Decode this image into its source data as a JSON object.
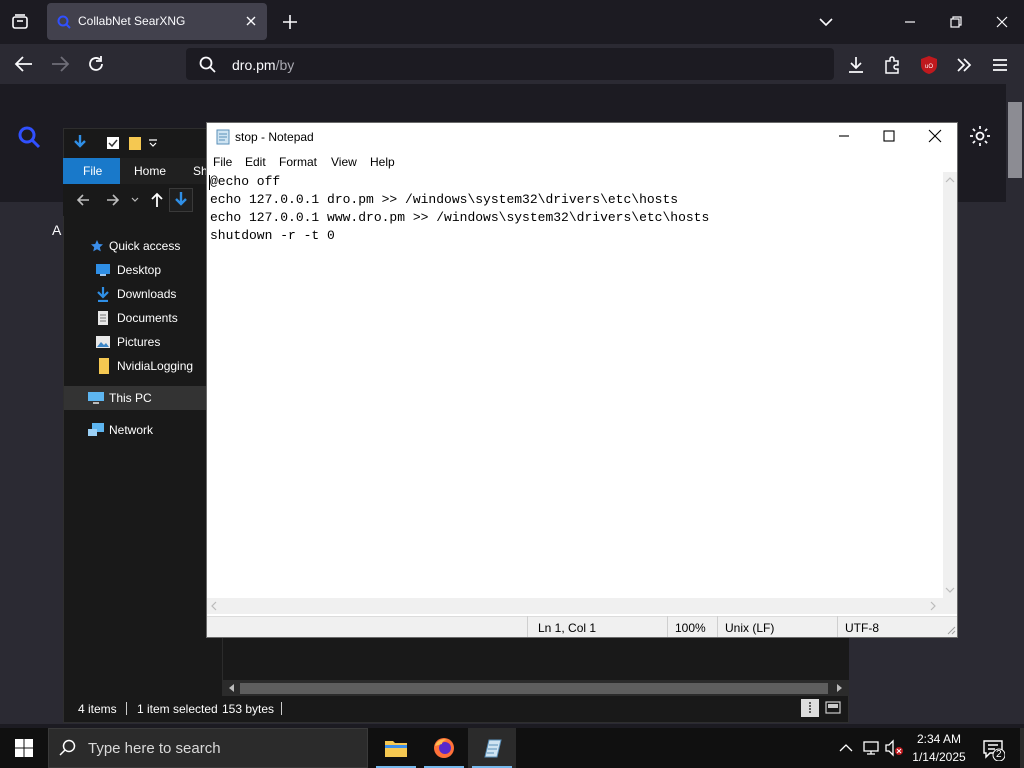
{
  "browser": {
    "tab_title": "CollabNet SearXNG",
    "url_host": "dro.pm",
    "url_path": "/by",
    "page_label_partial": "A"
  },
  "explorer": {
    "ribbon_tabs": [
      "File",
      "Home",
      "Sh"
    ],
    "nav_items": [
      {
        "label": "Quick access",
        "icon": "star-icon"
      },
      {
        "label": "Desktop",
        "icon": "desktop-icon"
      },
      {
        "label": "Downloads",
        "icon": "download-icon"
      },
      {
        "label": "Documents",
        "icon": "document-icon"
      },
      {
        "label": "Pictures",
        "icon": "picture-icon"
      },
      {
        "label": "NvidiaLogging",
        "icon": "folder-icon"
      },
      {
        "label": "This PC",
        "icon": "computer-icon"
      },
      {
        "label": "Network",
        "icon": "network-icon"
      }
    ],
    "status": {
      "items": "4 items",
      "selected": "1 item selected",
      "size": "153 bytes"
    }
  },
  "notepad": {
    "title": "stop - Notepad",
    "menu": [
      "File",
      "Edit",
      "Format",
      "View",
      "Help"
    ],
    "lines": [
      "@echo off",
      "echo 127.0.0.1 dro.pm >> /windows\\system32\\drivers\\etc\\hosts",
      "echo 127.0.0.1 www.dro.pm >> /windows\\system32\\drivers\\etc\\hosts",
      "shutdown -r -t 0"
    ],
    "status": {
      "position": "Ln 1, Col 1",
      "zoom": "100%",
      "line_ending": "Unix (LF)",
      "encoding": "UTF-8"
    }
  },
  "taskbar": {
    "search_placeholder": "Type here to search",
    "time": "2:34 AM",
    "date": "1/14/2025",
    "notification_count": "2"
  },
  "colors": {
    "accent": "#1979ca",
    "browser_bg": "#1c1b22",
    "toolbar_bg": "#2b2a33",
    "ublock_red": "#c0191e"
  }
}
